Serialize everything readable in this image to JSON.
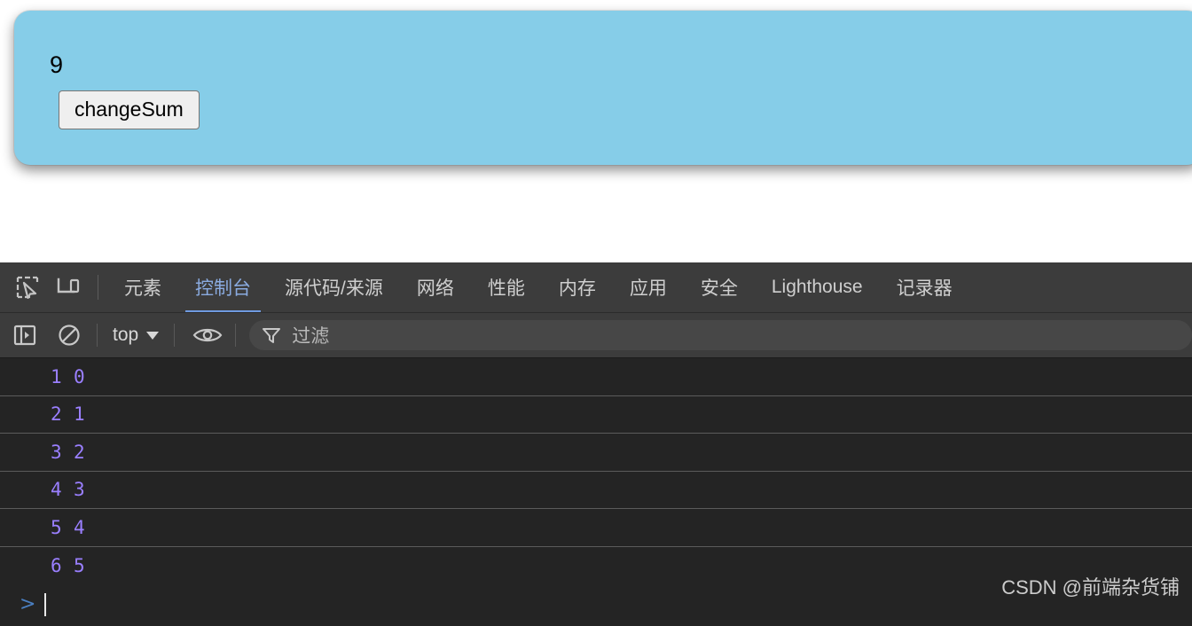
{
  "page": {
    "panel": {
      "background_color": "#86cde8",
      "sum_value": "9",
      "button_label": "changeSum"
    }
  },
  "devtools": {
    "tabs": [
      {
        "label": "元素",
        "active": false
      },
      {
        "label": "控制台",
        "active": true
      },
      {
        "label": "源代码/来源",
        "active": false
      },
      {
        "label": "网络",
        "active": false
      },
      {
        "label": "性能",
        "active": false
      },
      {
        "label": "内存",
        "active": false
      },
      {
        "label": "应用",
        "active": false
      },
      {
        "label": "安全",
        "active": false
      },
      {
        "label": "Lighthouse",
        "active": false
      },
      {
        "label": "记录器",
        "active": false
      }
    ],
    "tab_icons": [
      {
        "name": "inspect-element-icon"
      },
      {
        "name": "device-toolbar-icon"
      }
    ],
    "active_tab_color": "#8aabe0",
    "toolbar": {
      "sidebar_toggle_icon": "console-sidebar-icon",
      "clear_console_icon": "clear-console-icon",
      "context_value": "top",
      "live_expression_icon": "eye-icon",
      "filter_icon": "filter-funnel-icon",
      "filter_placeholder": "过滤"
    },
    "console": {
      "messages": [
        {
          "count": "1",
          "value": "0"
        },
        {
          "count": "2",
          "value": "1"
        },
        {
          "count": "3",
          "value": "2"
        },
        {
          "count": "4",
          "value": "3"
        },
        {
          "count": "5",
          "value": "4"
        },
        {
          "count": "6",
          "value": "5"
        }
      ],
      "value_color": "#9a7fff",
      "prompt_symbol": ">",
      "prompt_input_value": ""
    }
  },
  "watermark": {
    "text": "CSDN @前端杂货铺"
  }
}
